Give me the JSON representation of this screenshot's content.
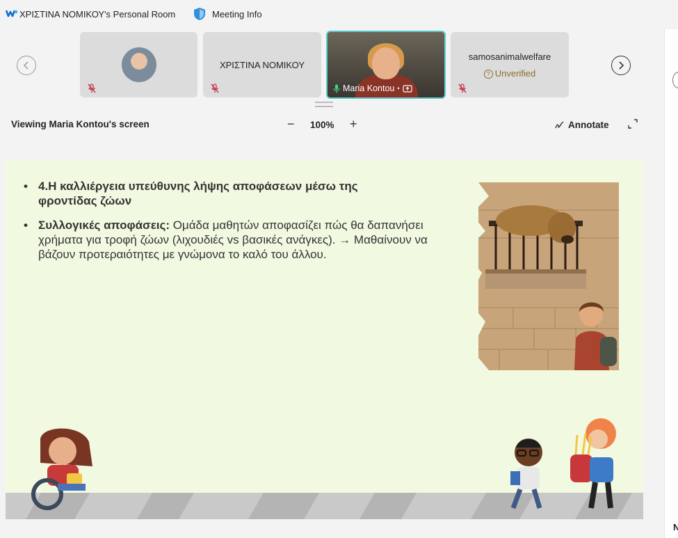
{
  "title_bar": {
    "room_title": "ΧΡΙΣΤΙΝΑ ΝΟΜΙΚΟΥ's Personal Room",
    "meeting_info": "Meeting Info"
  },
  "participants": [
    {
      "name": "",
      "muted": true
    },
    {
      "name": "ΧΡΙΣΤΙΝΑ ΝΟΜΙΚΟΥ",
      "muted": true
    },
    {
      "name": "Maria Kontou",
      "sharing": true
    },
    {
      "name": "samosanimalwelfare",
      "status": "Unverified",
      "muted": true
    }
  ],
  "share_bar": {
    "viewing": "Viewing Maria Kontou's screen",
    "zoom_minus": "−",
    "zoom_level": "100%",
    "zoom_plus": "+",
    "annotate": "Annotate"
  },
  "slide": {
    "bullet1": "4.Η καλλιέργεια υπεύθυνης λήψης αποφάσεων μέσω της φροντίδας ζώων",
    "bullet2_bold": "Συλλογικές αποφάσεις:",
    "bullet2_text": " Ομάδα μαθητών αποφασίζει πώς θα δαπανήσει χρήματα για τροφή ζώων (λιχουδιές vs βασικές ανάγκες). → Μαθαίνουν να βάζουν προτεραιότητες με γνώμονα το καλό του άλλου."
  },
  "right_panel": {
    "letter": "N"
  },
  "colors": {
    "active_border": "#5ccdcf",
    "slide_bg": "#f1fae1",
    "unverified": "#8a6d2a",
    "mute_red": "#c4314b"
  }
}
